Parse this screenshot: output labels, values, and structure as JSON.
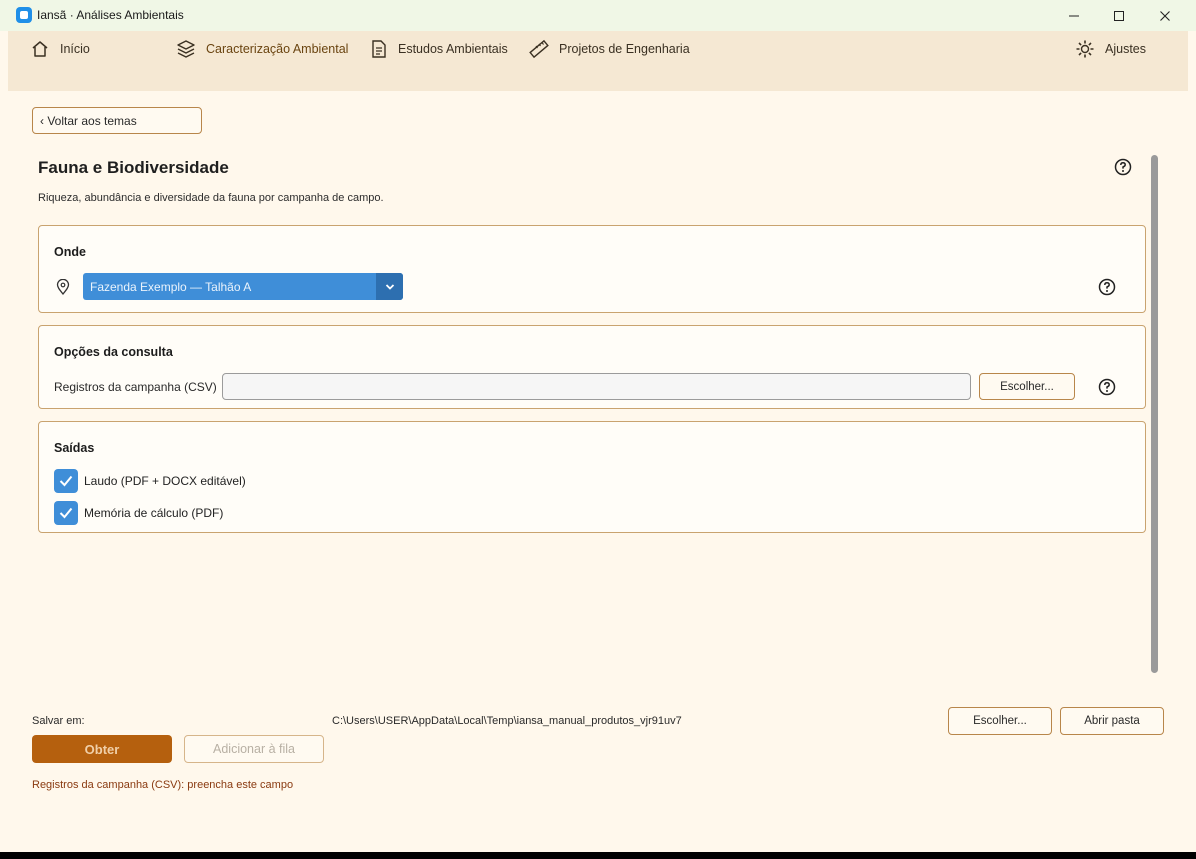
{
  "window": {
    "title": "Iansã · Análises Ambientais"
  },
  "nav": {
    "items": [
      {
        "label": "Início",
        "icon": "home-icon"
      },
      {
        "label": "Caracterização Ambiental",
        "icon": "layers-icon",
        "active": true
      },
      {
        "label": "Estudos Ambientais",
        "icon": "document-icon"
      },
      {
        "label": "Projetos de Engenharia",
        "icon": "ruler-icon"
      }
    ],
    "settings_label": "Ajustes"
  },
  "back_button": "‹ Voltar aos temas",
  "page": {
    "title": "Fauna e Biodiversidade",
    "description": "Riqueza, abundância e diversidade da fauna por campanha de campo."
  },
  "onde": {
    "title": "Onde",
    "selected_location": "Fazenda Exemplo — Talhão A"
  },
  "opcoes": {
    "title": "Opções da consulta",
    "csv_label": "Registros da campanha (CSV)",
    "csv_value": "",
    "choose_label": "Escolher..."
  },
  "saidas": {
    "title": "Saídas",
    "options": [
      {
        "label": "Laudo (PDF + DOCX editável)",
        "checked": true
      },
      {
        "label": "Memória de cálculo (PDF)",
        "checked": true
      }
    ]
  },
  "footer": {
    "save_label": "Salvar em:",
    "save_path": "C:\\Users\\USER\\AppData\\Local\\Temp\\iansa_manual_produtos_vjr91uv7",
    "choose_label": "Escolher...",
    "open_folder_label": "Abrir pasta",
    "primary_label": "Obter",
    "queue_label": "Adicionar à fila",
    "error_text": "Registros da campanha (CSV): preencha este campo"
  },
  "colors": {
    "accent": "#3f8ed8",
    "primary": "#b5600e",
    "border": "#c9a36f",
    "background": "#fff8ec"
  }
}
